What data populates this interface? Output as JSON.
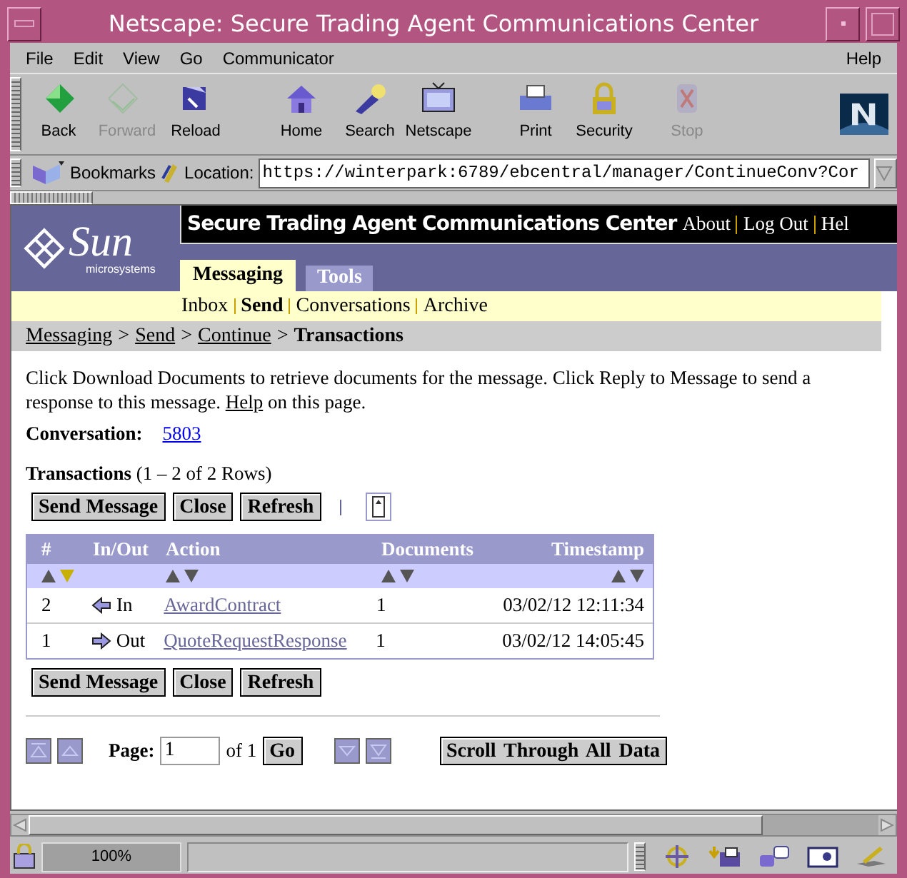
{
  "window": {
    "title": "Netscape: Secure Trading Agent Communications Center"
  },
  "menu": [
    {
      "label": "File",
      "kind": "left"
    },
    {
      "label": "Edit",
      "kind": "left"
    },
    {
      "label": "View",
      "kind": "left"
    },
    {
      "label": "Go",
      "kind": "left"
    },
    {
      "label": "Communicator",
      "kind": "left"
    },
    {
      "label": "Help",
      "kind": "right"
    }
  ],
  "toolbar": [
    {
      "label": "Back",
      "kind": "back",
      "disabled": false
    },
    {
      "label": "Forward",
      "kind": "forward",
      "disabled": true
    },
    {
      "label": "Reload",
      "kind": "reload",
      "disabled": false
    },
    {
      "label": "Home",
      "kind": "home",
      "disabled": false
    },
    {
      "label": "Search",
      "kind": "search",
      "disabled": false
    },
    {
      "label": "Netscape",
      "kind": "netscape",
      "disabled": false
    },
    {
      "label": "Print",
      "kind": "print",
      "disabled": false
    },
    {
      "label": "Security",
      "kind": "security",
      "disabled": false
    },
    {
      "label": "Stop",
      "kind": "stop",
      "disabled": true
    }
  ],
  "location_bar": {
    "bookmarks": "Bookmarks",
    "label": "Location:",
    "url": "https://winterpark:6789/ebcentral/manager/ContinueConv?Cor"
  },
  "page": {
    "logo": {
      "name": "Sun",
      "sub": "microsystems"
    },
    "header_title": "Secure Trading Agent Communications Center",
    "header_links": [
      "About",
      "Log Out",
      "Hel"
    ],
    "tabs": [
      {
        "label": "Messaging",
        "selected": true
      },
      {
        "label": "Tools",
        "selected": false
      }
    ],
    "subnav": [
      {
        "label": "Inbox",
        "selected": false
      },
      {
        "label": "Send",
        "selected": true
      },
      {
        "label": "Conversations",
        "selected": false
      },
      {
        "label": "Archive",
        "selected": false
      }
    ],
    "breadcrumb": [
      {
        "label": "Messaging",
        "link": true,
        "separator_after": ">"
      },
      {
        "label": "Send",
        "link": true,
        "separator_after": ">"
      },
      {
        "label": "Continue",
        "link": true,
        "separator_after": ">"
      },
      {
        "label": "Transactions",
        "link": false
      }
    ],
    "intro": {
      "text": "Click Download Documents to retrieve documents for the message. Click Reply to Message to send a response to this message.",
      "link": "Help",
      "after": "on this page."
    },
    "conversation": {
      "label": "Conversation:",
      "value": "5803"
    },
    "transactions": {
      "title": "Transactions",
      "range": "(1 – 2 of 2 Rows)"
    },
    "buttons_top": [
      "Send Message",
      "Close",
      "Refresh"
    ],
    "table": {
      "columns": [
        {
          "label": "#",
          "sortable": true,
          "sorted_descending": true
        },
        {
          "label": "In/Out",
          "sortable": false
        },
        {
          "label": "Action",
          "sortable": true,
          "sorted_descending": false
        },
        {
          "label": "Documents",
          "sortable": true,
          "sorted_descending": false
        },
        {
          "label": "Timestamp",
          "sortable": true,
          "sorted_descending": false
        }
      ],
      "rows": [
        {
          "number": "2",
          "incoming": true,
          "direction_label": "In",
          "action": "AwardContract",
          "documents": "1",
          "timestamp": "03/02/12 12:11:34"
        },
        {
          "number": "1",
          "incoming": false,
          "direction_label": "Out",
          "action": "QuoteRequestResponse",
          "documents": "1",
          "timestamp": "03/02/12 14:05:45"
        }
      ]
    },
    "buttons_bottom": [
      "Send Message",
      "Close",
      "Refresh"
    ],
    "pager": {
      "label": "Page:",
      "value": "1",
      "of": "of 1",
      "go": "Go",
      "scroll_all": "Scroll Through All Data"
    }
  },
  "status_bar": {
    "zoom": "100%"
  }
}
